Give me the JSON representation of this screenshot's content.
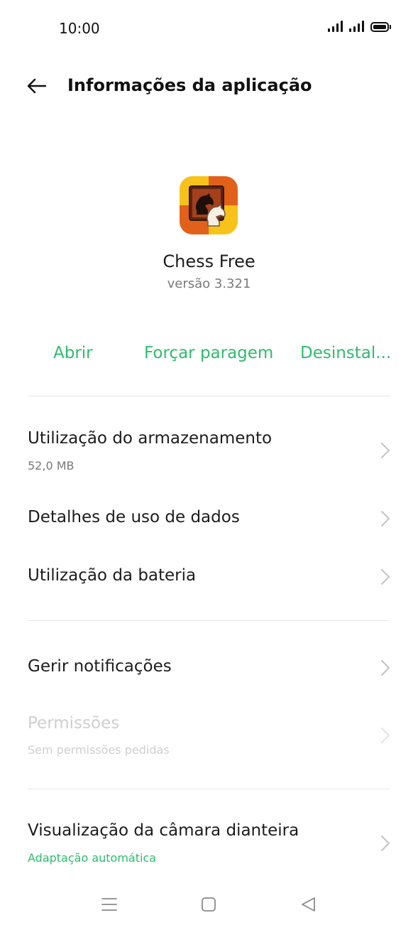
{
  "status_bar": {
    "time": "10:00"
  },
  "header": {
    "title": "Informações da aplicação"
  },
  "app": {
    "name": "Chess Free",
    "version": "versão 3.321"
  },
  "actions": {
    "open": "Abrir",
    "force_stop": "Forçar paragem",
    "uninstall": "Desinstal..."
  },
  "items": {
    "storage": {
      "title": "Utilização do armazenamento",
      "subtitle": "52,0 MB"
    },
    "data_usage": {
      "title": "Detalhes de uso de dados"
    },
    "battery": {
      "title": "Utilização da bateria"
    },
    "notifications": {
      "title": "Gerir notificações"
    },
    "permissions": {
      "title": "Permissões",
      "subtitle": "Sem permissões pedidas"
    },
    "front_camera": {
      "title": "Visualização da câmara dianteira",
      "subtitle": "Adaptação automática"
    }
  },
  "colors": {
    "accent": "#2fbb6e",
    "text": "#1c1c1c",
    "secondary": "#7a7a7a",
    "disabled": "#cfcfcf"
  }
}
